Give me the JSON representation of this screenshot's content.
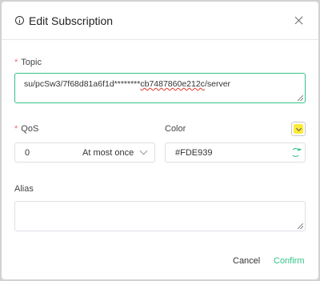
{
  "dialog": {
    "title": "Edit Subscription",
    "icons": {
      "info": "info-circle-icon",
      "close": "close-icon"
    }
  },
  "topic": {
    "label": "Topic",
    "required_mark": "*",
    "value_prefix": "su/pcSw3/7f68d81a6f1d********",
    "value_underlined": "cb7487860e212c",
    "value_suffix": "/server"
  },
  "qos": {
    "label": "QoS",
    "required_mark": "*",
    "value": "0",
    "value_name": "At most once"
  },
  "color": {
    "label": "Color",
    "value": "#FDE939",
    "swatch_color": "#FDE939",
    "icon": "refresh-icon"
  },
  "alias": {
    "label": "Alias",
    "value": ""
  },
  "footer": {
    "cancel": "Cancel",
    "confirm": "Confirm"
  },
  "theme": {
    "accent": "#34c388",
    "required": "#f56c6c"
  }
}
